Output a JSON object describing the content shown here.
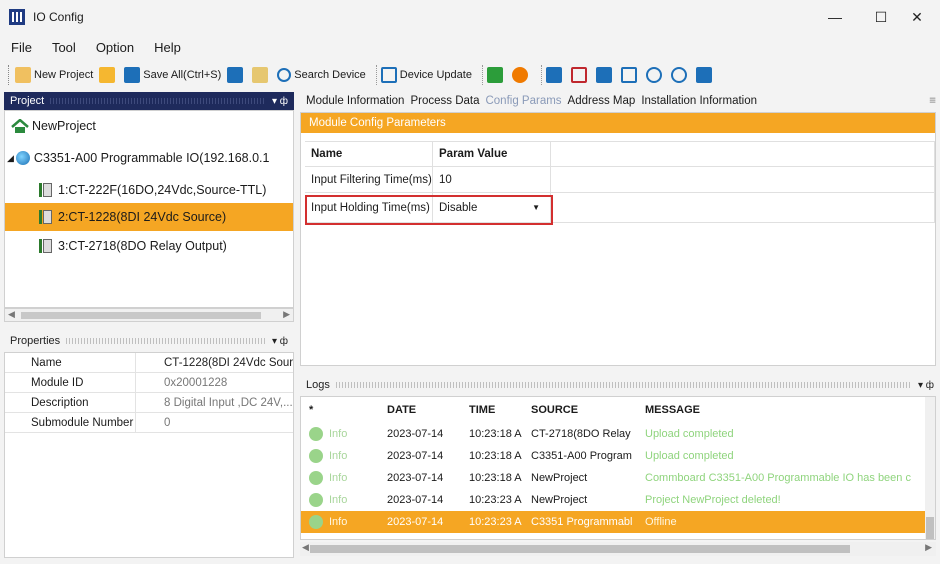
{
  "window": {
    "title": "IO Config"
  },
  "menu": [
    "File",
    "Tool",
    "Option",
    "Help"
  ],
  "toolbar": {
    "new_project": "New Project",
    "save_all": "Save All(Ctrl+S)",
    "search_device": "Search Device",
    "device_update": "Device Update"
  },
  "project_panel": {
    "title": "Project",
    "root": "NewProject",
    "device": "C3351-A00 Programmable IO(192.168.0.1",
    "modules": [
      {
        "label": "1:CT-222F(16DO,24Vdc,Source-TTL)"
      },
      {
        "label": "2:CT-1228(8DI 24Vdc Source)"
      },
      {
        "label": "3:CT-2718(8DO Relay Output)"
      }
    ]
  },
  "properties_panel": {
    "title": "Properties",
    "rows": [
      {
        "key": "Name",
        "value": "CT-1228(8DI 24Vdc Sourc"
      },
      {
        "key": "Module ID",
        "value": "0x20001228"
      },
      {
        "key": "Description",
        "value": "8 Digital Input ,DC 24V,..."
      },
      {
        "key": "Submodule Number",
        "value": "0"
      }
    ]
  },
  "tabs": [
    "Module Information",
    "Process Data",
    "Config Params",
    "Address Map",
    "Installation Information"
  ],
  "config": {
    "header": "Module Config Parameters",
    "columns": [
      "Name",
      "Param Value"
    ],
    "rows": [
      {
        "name": "Input Filtering Time(ms)",
        "value": "10"
      },
      {
        "name": "Input Holding Time(ms)",
        "value": "Disable"
      }
    ]
  },
  "logs": {
    "title": "Logs",
    "columns": [
      "*",
      "DATE",
      "TIME",
      "SOURCE",
      "MESSAGE"
    ],
    "rows": [
      {
        "level": "Info",
        "date": "2023-07-14",
        "time": "10:23:18 A",
        "source": "CT-2718(8DO Relay",
        "message": "Upload completed"
      },
      {
        "level": "Info",
        "date": "2023-07-14",
        "time": "10:23:18 A",
        "source": "C3351-A00 Program",
        "message": "Upload completed"
      },
      {
        "level": "Info",
        "date": "2023-07-14",
        "time": "10:23:18 A",
        "source": "NewProject",
        "message": "Commboard C3351-A00 Programmable IO has been c"
      },
      {
        "level": "Info",
        "date": "2023-07-14",
        "time": "10:23:23 A",
        "source": "NewProject",
        "message": "Project NewProject deleted!"
      },
      {
        "level": "Info",
        "date": "2023-07-14",
        "time": "10:23:23 A",
        "source": "C3351 Programmabl",
        "message": "Offline"
      }
    ]
  },
  "colors": {
    "accent": "#f5a623",
    "panel_header": "#1e2a5c",
    "highlight": "#d32f2f"
  }
}
